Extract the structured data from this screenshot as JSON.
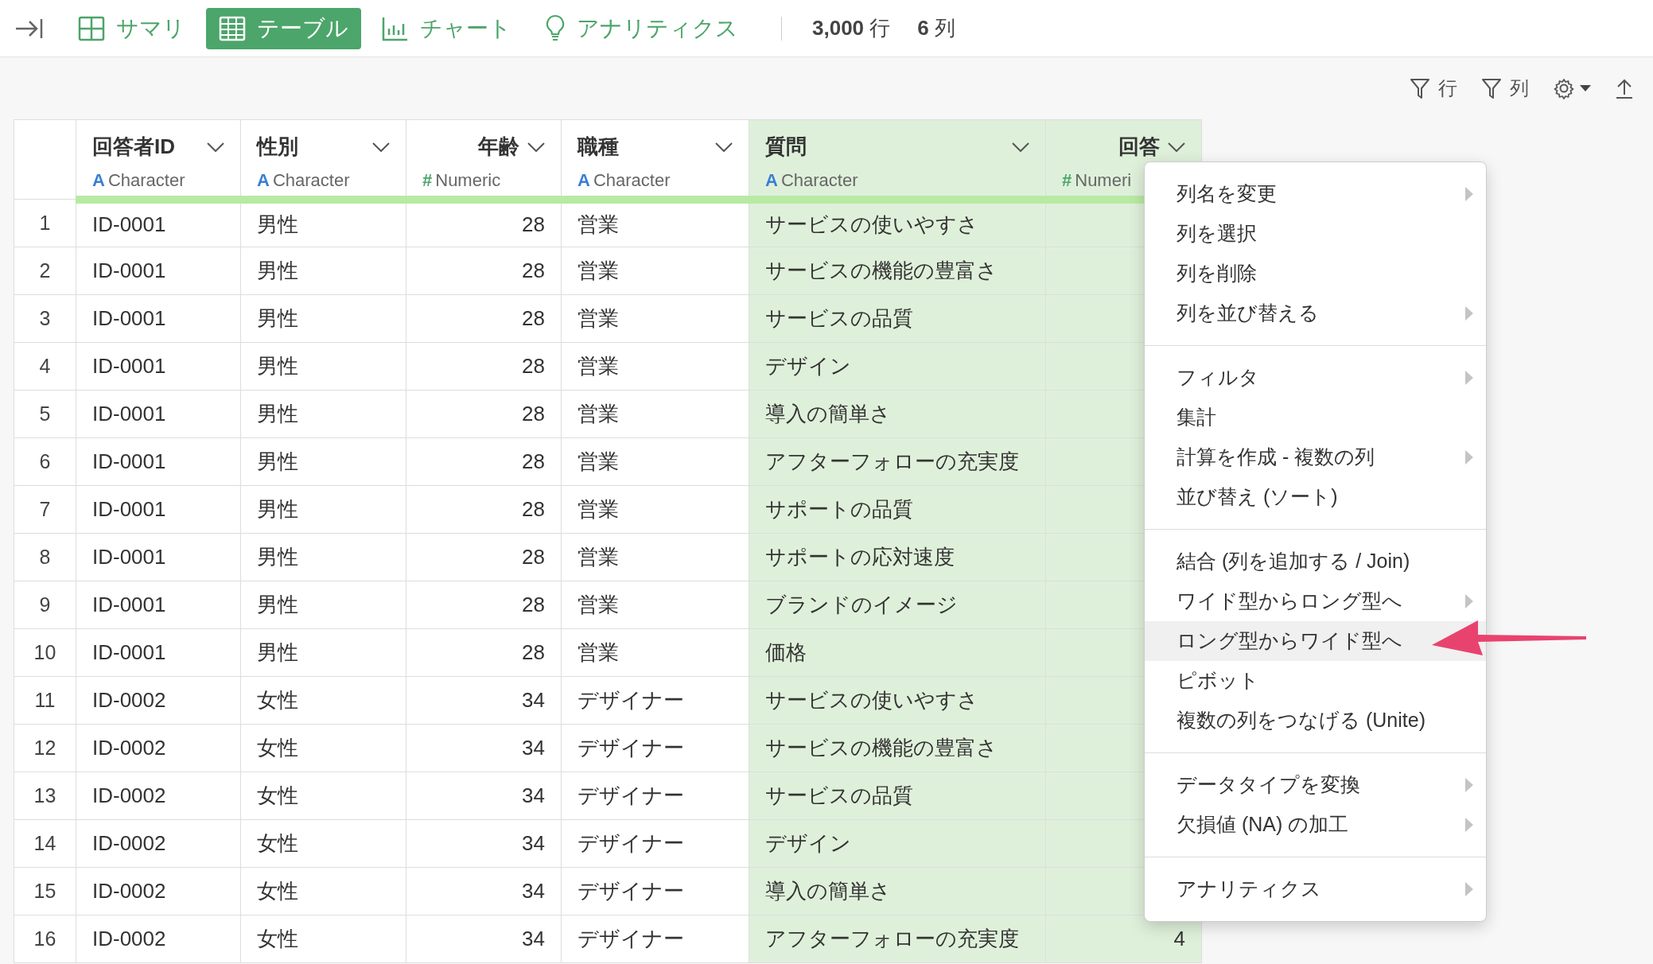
{
  "tabs": [
    {
      "label": "サマリ",
      "kind": "summary",
      "selected": false
    },
    {
      "label": "テーブル",
      "kind": "table",
      "selected": true
    },
    {
      "label": "チャート",
      "kind": "chart",
      "selected": false
    },
    {
      "label": "アナリティクス",
      "kind": "analytics",
      "selected": false
    }
  ],
  "counts": [
    "**3,000** 行",
    "**6** 列"
  ],
  "toolbar": {
    "row_filter": "行",
    "column_filter": "列"
  },
  "columns": [
    {
      "name": "回答者ID",
      "type_icon": "A",
      "type_label": "Character",
      "kind": "character",
      "selected": false
    },
    {
      "name": "性別",
      "type_icon": "A",
      "type_label": "Character",
      "kind": "character",
      "selected": false
    },
    {
      "name": "年齢",
      "type_icon": "#",
      "type_label": "Numeric",
      "kind": "numeric",
      "selected": false
    },
    {
      "name": "職種",
      "type_icon": "A",
      "type_label": "Character",
      "kind": "character",
      "selected": false
    },
    {
      "name": "質問",
      "type_icon": "A",
      "type_label": "Character",
      "kind": "character",
      "selected": true
    },
    {
      "name": "回答",
      "type_icon": "#",
      "type_label": "Numeri",
      "kind": "numeric",
      "selected": true
    }
  ],
  "rows": [
    {
      "num": "1",
      "cells": [
        "ID-0001",
        "男性",
        "28",
        "営業",
        "サービスの使いやすさ"
      ]
    },
    {
      "num": "2",
      "cells": [
        "ID-0001",
        "男性",
        "28",
        "営業",
        "サービスの機能の豊富さ"
      ]
    },
    {
      "num": "3",
      "cells": [
        "ID-0001",
        "男性",
        "28",
        "営業",
        "サービスの品質"
      ]
    },
    {
      "num": "4",
      "cells": [
        "ID-0001",
        "男性",
        "28",
        "営業",
        "デザイン"
      ]
    },
    {
      "num": "5",
      "cells": [
        "ID-0001",
        "男性",
        "28",
        "営業",
        "導入の簡単さ"
      ]
    },
    {
      "num": "6",
      "cells": [
        "ID-0001",
        "男性",
        "28",
        "営業",
        "アフターフォローの充実度"
      ]
    },
    {
      "num": "7",
      "cells": [
        "ID-0001",
        "男性",
        "28",
        "営業",
        "サポートの品質"
      ]
    },
    {
      "num": "8",
      "cells": [
        "ID-0001",
        "男性",
        "28",
        "営業",
        "サポートの応対速度"
      ]
    },
    {
      "num": "9",
      "cells": [
        "ID-0001",
        "男性",
        "28",
        "営業",
        "ブランドのイメージ"
      ]
    },
    {
      "num": "10",
      "cells": [
        "ID-0001",
        "男性",
        "28",
        "営業",
        "価格"
      ]
    },
    {
      "num": "11",
      "cells": [
        "ID-0002",
        "女性",
        "34",
        "デザイナー",
        "サービスの使いやすさ"
      ]
    },
    {
      "num": "12",
      "cells": [
        "ID-0002",
        "女性",
        "34",
        "デザイナー",
        "サービスの機能の豊富さ"
      ]
    },
    {
      "num": "13",
      "cells": [
        "ID-0002",
        "女性",
        "34",
        "デザイナー",
        "サービスの品質"
      ]
    },
    {
      "num": "14",
      "cells": [
        "ID-0002",
        "女性",
        "34",
        "デザイナー",
        "デザイン"
      ]
    },
    {
      "num": "15",
      "cells": [
        "ID-0002",
        "女性",
        "34",
        "デザイナー",
        "導入の簡単さ"
      ]
    },
    {
      "num": "16",
      "cells": [
        "ID-0002",
        "女性",
        "34",
        "デザイナー",
        "アフターフォローの充実度",
        "4"
      ]
    }
  ],
  "context_menu": [
    [
      {
        "label": "列名を変更",
        "submenu": true,
        "selected": false
      },
      {
        "label": "列を選択",
        "submenu": false,
        "selected": false
      },
      {
        "label": "列を削除",
        "submenu": false,
        "selected": false
      },
      {
        "label": "列を並び替える",
        "submenu": true,
        "selected": false
      }
    ],
    [
      {
        "label": "フィルタ",
        "submenu": true,
        "selected": false
      },
      {
        "label": "集計",
        "submenu": false,
        "selected": false
      },
      {
        "label": "計算を作成 - 複数の列",
        "submenu": true,
        "selected": false
      },
      {
        "label": "並び替え (ソート)",
        "submenu": false,
        "selected": false
      }
    ],
    [
      {
        "label": "結合 (列を追加する / Join)",
        "submenu": false,
        "selected": false
      },
      {
        "label": "ワイド型からロング型へ",
        "submenu": true,
        "selected": false
      },
      {
        "label": "ロング型からワイド型へ",
        "submenu": false,
        "selected": true
      },
      {
        "label": "ピボット",
        "submenu": false,
        "selected": false
      },
      {
        "label": "複数の列をつなげる (Unite)",
        "submenu": false,
        "selected": false
      }
    ],
    [
      {
        "label": "データタイプを変換",
        "submenu": true,
        "selected": false
      },
      {
        "label": "欠損値 (NA) の加工",
        "submenu": true,
        "selected": false
      }
    ],
    [
      {
        "label": "アナリティクス",
        "submenu": true,
        "selected": false
      }
    ]
  ]
}
